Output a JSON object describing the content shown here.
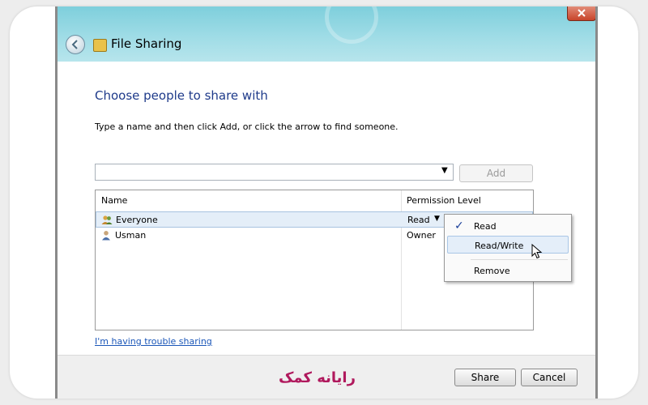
{
  "window": {
    "title": "File Sharing"
  },
  "main": {
    "heading": "Choose people to share with",
    "instruction": "Type a name and then click Add, or click the arrow to find someone.",
    "name_input": {
      "value": "",
      "placeholder": ""
    },
    "add_label": "Add",
    "table": {
      "columns": [
        "Name",
        "Permission Level"
      ],
      "rows": [
        {
          "name": "Everyone",
          "permission": "Read",
          "icon": "group-icon",
          "selected": true
        },
        {
          "name": "Usman",
          "permission": "Owner",
          "icon": "user-icon",
          "selected": false
        }
      ]
    },
    "trouble_link": "I'm having trouble sharing"
  },
  "permission_menu": {
    "items": [
      "Read",
      "Read/Write",
      "Remove"
    ],
    "checked": "Read",
    "highlighted": "Read/Write"
  },
  "footer": {
    "share_label": "Share",
    "cancel_label": "Cancel"
  },
  "watermark": {
    "text": "رایانه کمک"
  },
  "colors": {
    "heading": "#1e3a8a",
    "link": "#1a56b8",
    "titlebar": "#9fdce6",
    "watermark": "#b0195d"
  }
}
